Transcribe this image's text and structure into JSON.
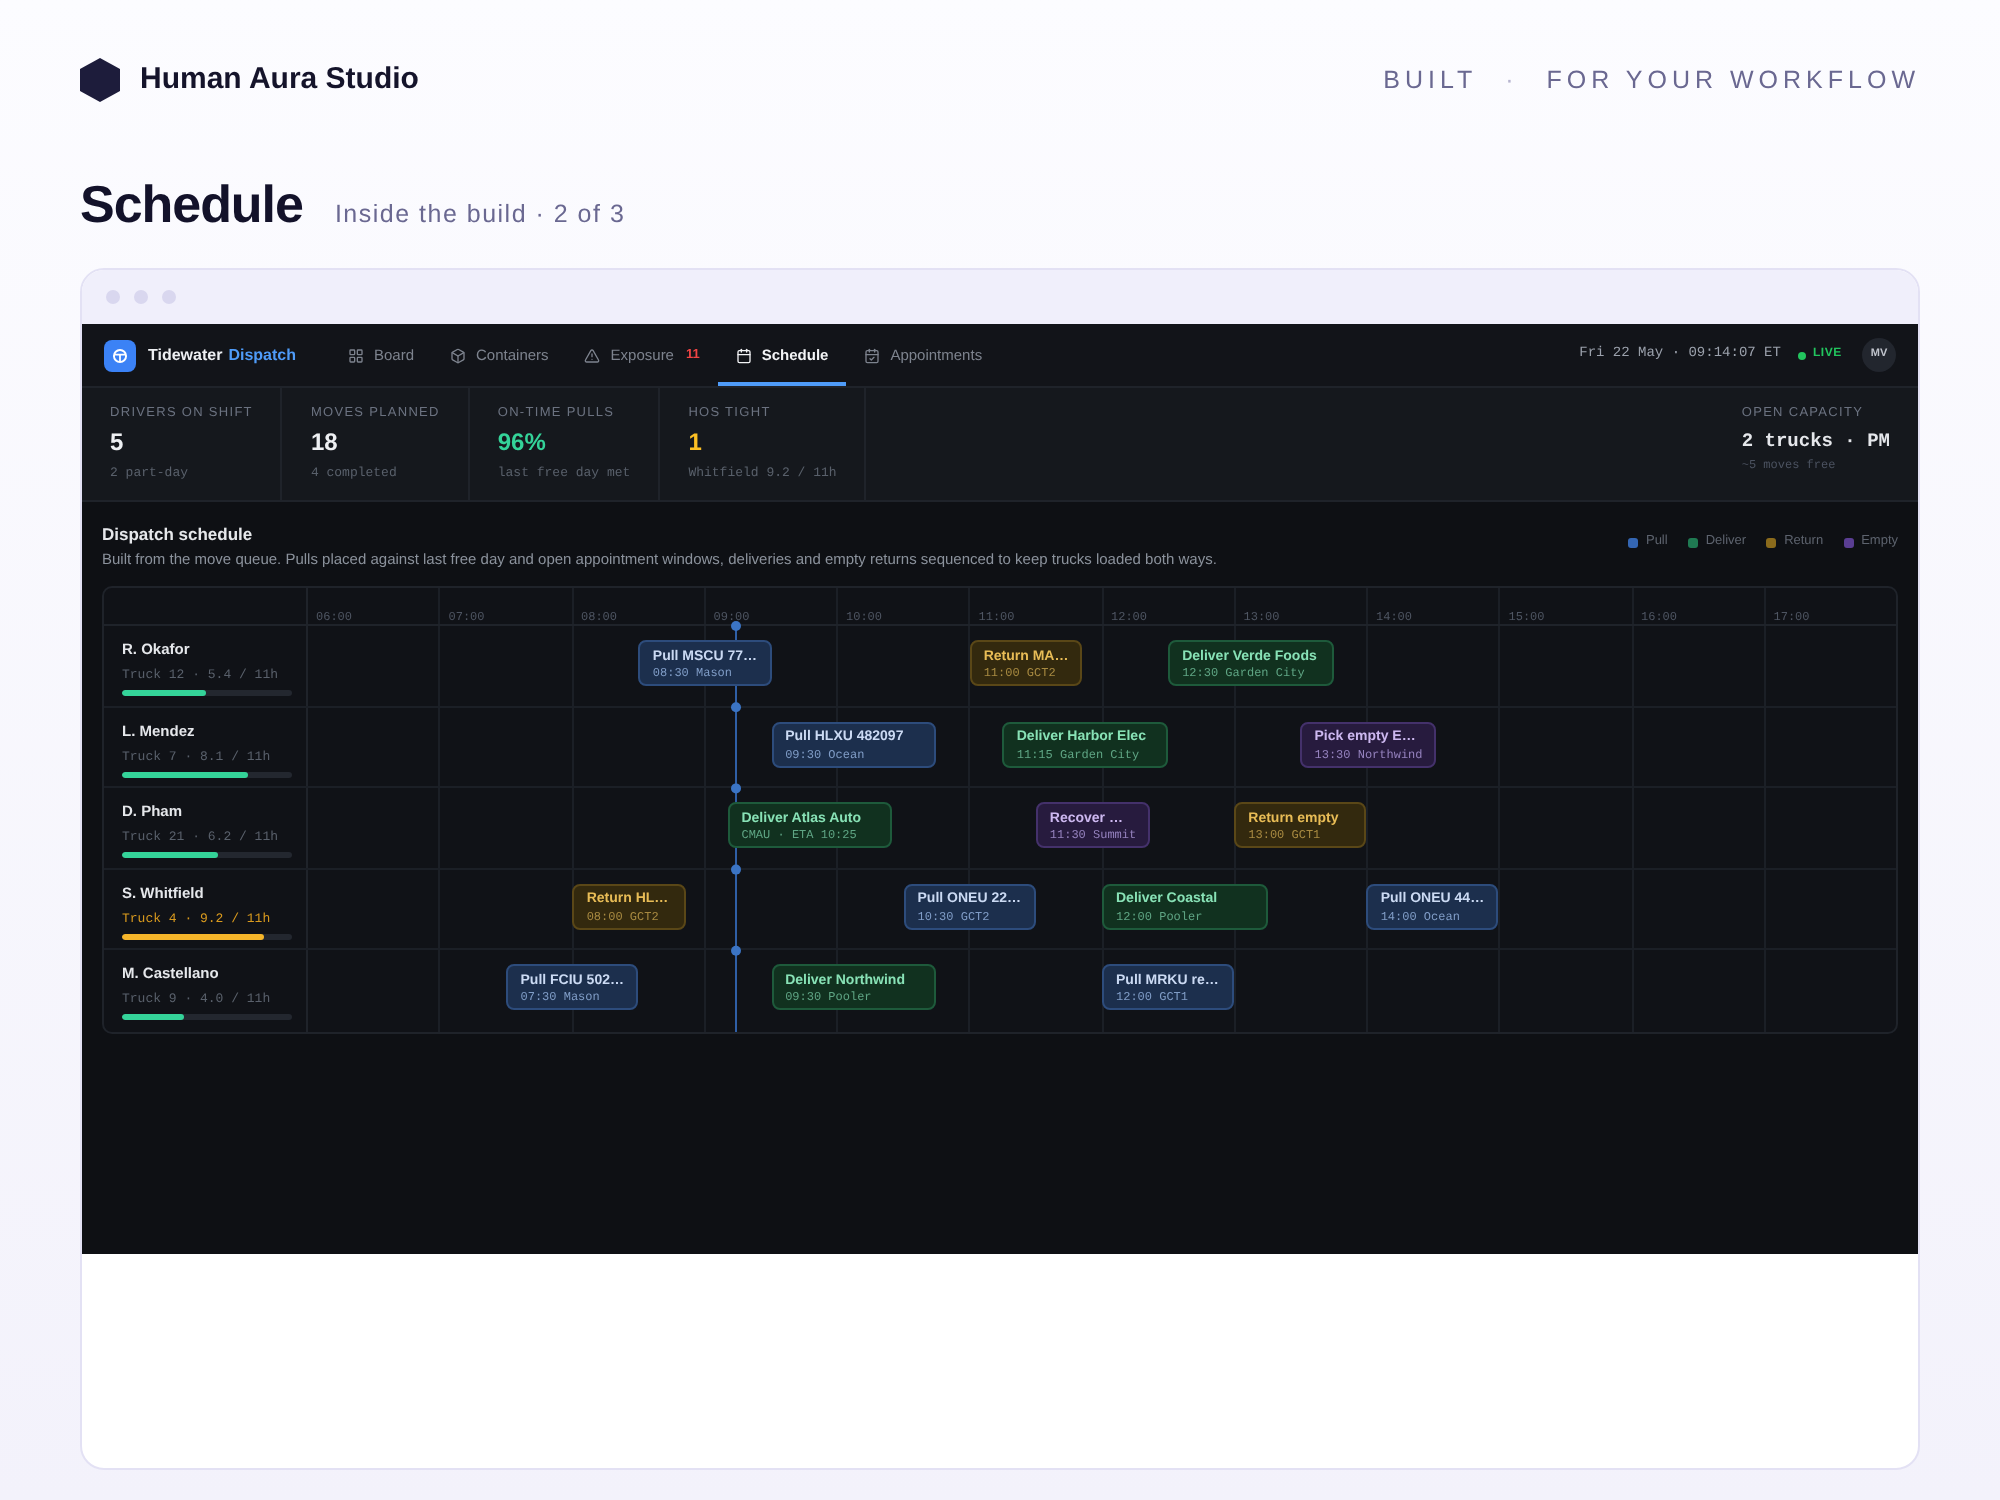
{
  "header": {
    "brand": "Human Aura Studio",
    "tagline": {
      "left": "BUILT",
      "separator": "·",
      "right": "FOR YOUR WORKFLOW"
    }
  },
  "page": {
    "title": "Schedule",
    "subtitle": "Inside the build · 2 of 3"
  },
  "app": {
    "brand": {
      "name": "Tidewater",
      "accent": "Dispatch"
    },
    "tabs": [
      {
        "label": "Board",
        "selected": false
      },
      {
        "label": "Containers",
        "selected": false
      },
      {
        "label": "Exposure",
        "badge": "11",
        "selected": false
      },
      {
        "label": "Schedule",
        "selected": true
      },
      {
        "label": "Appointments",
        "selected": false
      }
    ],
    "clock": "Fri 22 May · 09:14:07 ET",
    "live": "LIVE",
    "avatar": "MV",
    "stats": [
      {
        "label": "DRIVERS ON SHIFT",
        "value": "5",
        "note": "2 part-day",
        "color": "#eef0f3"
      },
      {
        "label": "MOVES PLANNED",
        "value": "18",
        "note": "4 completed",
        "color": "#eef0f3"
      },
      {
        "label": "ON-TIME PULLS",
        "value": "96%",
        "note": "last free day met",
        "color": "#34d399"
      },
      {
        "label": "HOS TIGHT",
        "value": "1",
        "note": "Whitfield 9.2 / 11h",
        "color": "#fbbf24"
      }
    ],
    "capacity": {
      "label": "OPEN CAPACITY",
      "value": "2 trucks · PM",
      "note": "~5 moves free"
    },
    "schedule": {
      "title": "Dispatch schedule",
      "description": "Built from the move queue. Pulls placed against last free day and open appointment windows, deliveries and empty returns sequenced to keep trucks loaded both ways.",
      "legend": [
        {
          "label": "Pull",
          "kind": "pull"
        },
        {
          "label": "Deliver",
          "kind": "deliver"
        },
        {
          "label": "Return",
          "kind": "return"
        },
        {
          "label": "Empty",
          "kind": "empty"
        }
      ],
      "hours": [
        "06:00",
        "07:00",
        "08:00",
        "09:00",
        "10:00",
        "11:00",
        "12:00",
        "13:00",
        "14:00",
        "15:00",
        "16:00",
        "17:00"
      ],
      "drivers": [
        {
          "name": "R. Okafor",
          "truck": "Truck 12 · 5.4 / 11h",
          "level": 0.49,
          "hos_tight": false,
          "moves": [
            {
              "kind": "pull",
              "title": "Pull MSCU 77…",
              "detail": "08:30 Mason"
            },
            {
              "kind": "return",
              "title": "Return MA…",
              "detail": "11:00 GCT2"
            },
            {
              "kind": "deliver",
              "title": "Deliver Verde Foods",
              "detail": "12:30 Garden City"
            }
          ]
        },
        {
          "name": "L. Mendez",
          "truck": "Truck 7 · 8.1 / 11h",
          "level": 0.74,
          "hos_tight": false,
          "moves": [
            {
              "kind": "pull",
              "title": "Pull HLXU 482097",
              "detail": "09:30 Ocean"
            },
            {
              "kind": "deliver",
              "title": "Deliver Harbor Elec",
              "detail": "11:15 Garden City"
            },
            {
              "kind": "empty",
              "title": "Pick empty E…",
              "detail": "13:30 Northwind"
            }
          ]
        },
        {
          "name": "D. Pham",
          "truck": "Truck 21 · 6.2 / 11h",
          "level": 0.56,
          "hos_tight": false,
          "moves": [
            {
              "kind": "deliver",
              "title": "Deliver Atlas Auto",
              "detail": "CMAU · ETA 10:25"
            },
            {
              "kind": "empty",
              "title": "Recover …",
              "detail": "11:30 Summit"
            },
            {
              "kind": "return",
              "title": "Return empty",
              "detail": "13:00 GCT1"
            }
          ]
        },
        {
          "name": "S. Whitfield",
          "truck": "Truck 4 · 9.2 / 11h",
          "level": 0.84,
          "hos_tight": true,
          "moves": [
            {
              "kind": "return",
              "title": "Return HL…",
              "detail": "08:00 GCT2"
            },
            {
              "kind": "pull",
              "title": "Pull ONEU 22…",
              "detail": "10:30 GCT2"
            },
            {
              "kind": "deliver",
              "title": "Deliver Coastal",
              "detail": "12:00 Pooler"
            },
            {
              "kind": "pull",
              "title": "Pull ONEU 44…",
              "detail": "14:00 Ocean"
            }
          ]
        },
        {
          "name": "M. Castellano",
          "truck": "Truck 9 · 4.0 / 11h",
          "level": 0.36,
          "hos_tight": false,
          "moves": [
            {
              "kind": "pull",
              "title": "Pull FCIU 502…",
              "detail": "07:30 Mason"
            },
            {
              "kind": "deliver",
              "title": "Deliver Northwind",
              "detail": "09:30 Pooler"
            },
            {
              "kind": "pull",
              "title": "Pull MRKU re…",
              "detail": "12:00 GCT1"
            }
          ]
        }
      ]
    }
  }
}
